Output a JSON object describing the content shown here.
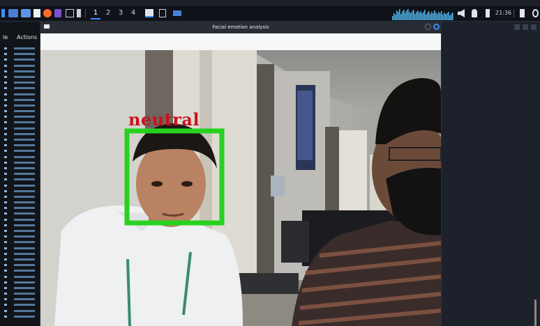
{
  "window": {
    "title": "Facial emotion analysis"
  },
  "workspaces": [
    "1",
    "2",
    "3",
    "4"
  ],
  "active_workspace": "1",
  "tray": {
    "clock": "21:36"
  },
  "terminal": {
    "col1": "le",
    "col2": "Actions",
    "line_count": 48
  },
  "detection": {
    "label": "neutral",
    "box_color": "#27d21f",
    "label_color": "#c8121b"
  },
  "colors": {
    "panel": "#0f1218",
    "accent": "#3b8cff",
    "audio_meter": "#4fb3e8"
  }
}
